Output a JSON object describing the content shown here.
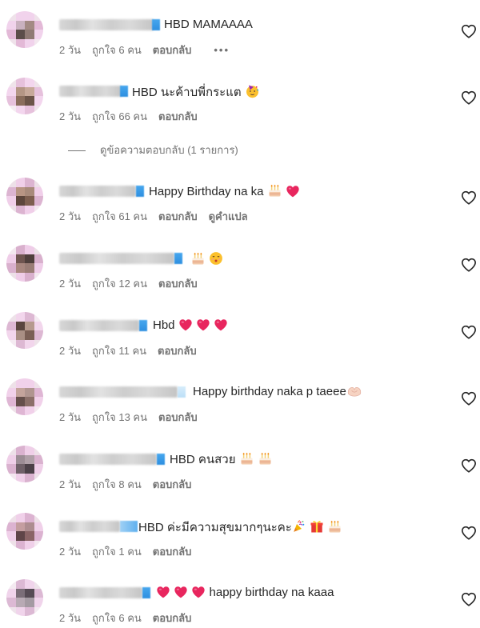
{
  "comments": [
    {
      "text": "HBD MAMAAAA",
      "time": "2 วัน",
      "likes": "ถูกใจ 6 คน",
      "reply": "ตอบกลับ",
      "more": "•••",
      "translate": ""
    },
    {
      "text": "HBD นะค้าบพี่กระแต",
      "time": "2 วัน",
      "likes": "ถูกใจ 66 คน",
      "reply": "ตอบกลับ",
      "more": "",
      "translate": ""
    },
    {
      "text": "Happy Birthday na ka",
      "time": "2 วัน",
      "likes": "ถูกใจ 61 คน",
      "reply": "ตอบกลับ",
      "more": "",
      "translate": "ดูคำแปล"
    },
    {
      "text": "",
      "time": "2 วัน",
      "likes": "ถูกใจ 12 คน",
      "reply": "ตอบกลับ",
      "more": "",
      "translate": ""
    },
    {
      "text": "Hbd",
      "time": "2 วัน",
      "likes": "ถูกใจ 11 คน",
      "reply": "ตอบกลับ",
      "more": "",
      "translate": ""
    },
    {
      "text": "Happy birthday naka p taeee",
      "time": "2 วัน",
      "likes": "ถูกใจ 13 คน",
      "reply": "ตอบกลับ",
      "more": "",
      "translate": ""
    },
    {
      "text": "HBD คนสวย",
      "time": "2 วัน",
      "likes": "ถูกใจ 8 คน",
      "reply": "ตอบกลับ",
      "more": "",
      "translate": ""
    },
    {
      "text": "HBD ค่ะมีความสุขมากๆนะคะ",
      "time": "2 วัน",
      "likes": "ถูกใจ 1 คน",
      "reply": "ตอบกลับ",
      "more": "",
      "translate": ""
    },
    {
      "text": "happy birthday na kaaa",
      "time": "2 วัน",
      "likes": "ถูกใจ 6 คน",
      "reply": "ตอบกลับ",
      "more": "",
      "translate": ""
    }
  ],
  "view_replies": "ดูข้อความตอบกลับ (1 รายการ)",
  "icons": {
    "like": "heart-outline-icon",
    "cake": "birthday-cake-emoji",
    "red_heart": "red-heart-emoji",
    "kiss": "kissing-face-emoji",
    "party": "party-face-emoji",
    "popper": "party-popper-emoji",
    "gift": "gift-emoji",
    "hands": "heart-hands-emoji"
  },
  "colors": {
    "text": "#262626",
    "meta": "#737373",
    "heart": "#e8265e",
    "name_tail": "#2d8fe0"
  }
}
